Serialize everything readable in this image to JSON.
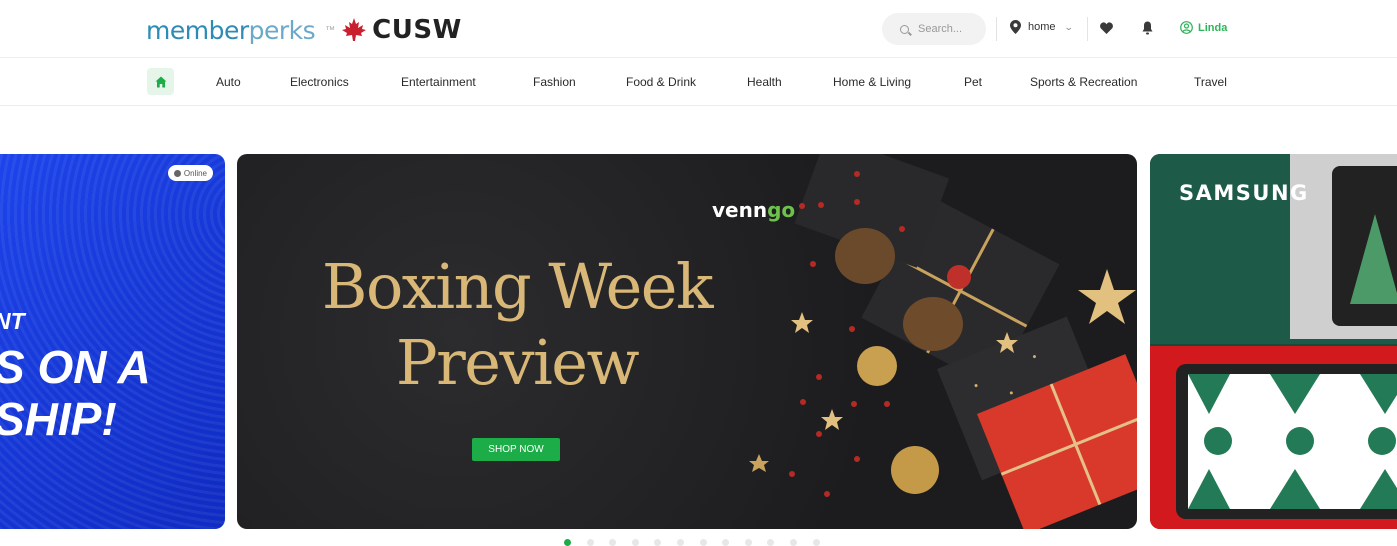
{
  "header": {
    "brand_member": "member",
    "brand_perks": "perks",
    "brand_tm": "™",
    "brand_partner": "CUSW",
    "search_placeholder": "Search...",
    "location_label": "home",
    "user_name": "Linda"
  },
  "nav": {
    "items": [
      "Auto",
      "Electronics",
      "Entertainment",
      "Fashion",
      "Food & Drink",
      "Health",
      "Home & Living",
      "Pet",
      "Sports & Recreation",
      "Travel"
    ]
  },
  "carousel": {
    "left_slide": {
      "badge": "Online",
      "line1": "NT",
      "line2": "S ON A",
      "line3": "SHIP!"
    },
    "main_slide": {
      "brand_a": "venn",
      "brand_b": "go",
      "title_line1": "Boxing Week",
      "title_line2": "Preview",
      "cta": "SHOP NOW"
    },
    "right_slide": {
      "brand": "SAMSUNG"
    },
    "page_count": 12,
    "active_index": 0
  },
  "colors": {
    "accent_green": "#1cad48",
    "brand_blue": "#2d8bb5",
    "gold": "#d9b777",
    "cusw_red": "#c8202f"
  }
}
